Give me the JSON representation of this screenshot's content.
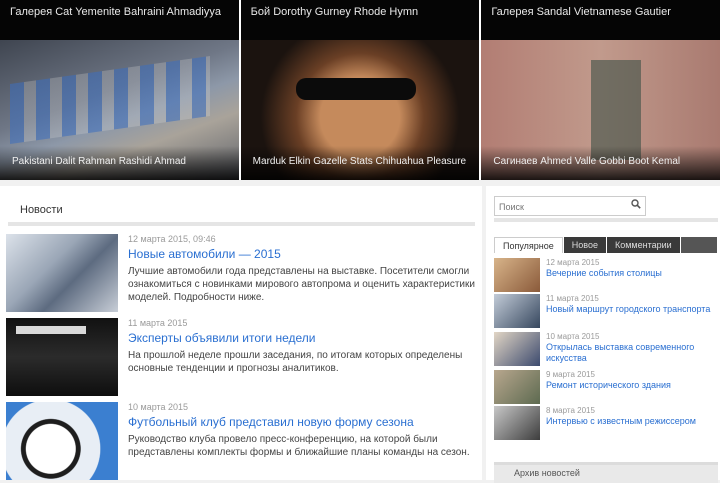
{
  "featured": [
    {
      "caption": "Галерея Cat Yemenite Bahraini Ahmadiyya",
      "overlay": "Pakistani Dalit Rahman Rashidi Ahmad"
    },
    {
      "caption": "Бой Dorothy Gurney Rhode Hymn",
      "overlay": "Marduk Elkin Gazelle Stats Chihuahua Pleasure"
    },
    {
      "caption": "Галерея Sandal Vietnamese Gautier",
      "overlay": "Сагинаев Ahmed Valle Gobbi Boot Kemal"
    }
  ],
  "main": {
    "section_title": "Новости",
    "articles": [
      {
        "date": "12 марта 2015, 09:46",
        "title": "Новые автомобили — 2015",
        "summary": "Лучшие автомобили года представлены на выставке. Посетители смогли ознакомиться с новинками мирового автопрома и оценить характеристики моделей. Подробности ниже."
      },
      {
        "date": "11 марта 2015",
        "title": "Эксперты объявили итоги недели",
        "summary": "На прошлой неделе прошли заседания, по итогам которых определены основные тенденции и прогнозы аналитиков."
      },
      {
        "date": "10 марта 2015",
        "title": "Футбольный клуб представил новую форму сезона",
        "summary": "Руководство клуба провело пресс-конференцию, на которой были представлены комплекты формы и ближайшие планы команды на сезон."
      }
    ]
  },
  "sidebar": {
    "search_placeholder": "Поиск",
    "tabs": [
      "Популярное",
      "Новое",
      "Комментарии"
    ],
    "items": [
      {
        "date": "12 марта 2015",
        "title": "Вечерние события столицы"
      },
      {
        "date": "11 марта 2015",
        "title": "Новый маршрут городского транспорта"
      },
      {
        "date": "10 марта 2015",
        "title": "Открылась выставка современного искусства"
      },
      {
        "date": "9 марта 2015",
        "title": "Ремонт исторического здания"
      },
      {
        "date": "8 марта 2015",
        "title": "Интервью с известным режиссером"
      }
    ],
    "bottom_label": "Архив новостей"
  }
}
